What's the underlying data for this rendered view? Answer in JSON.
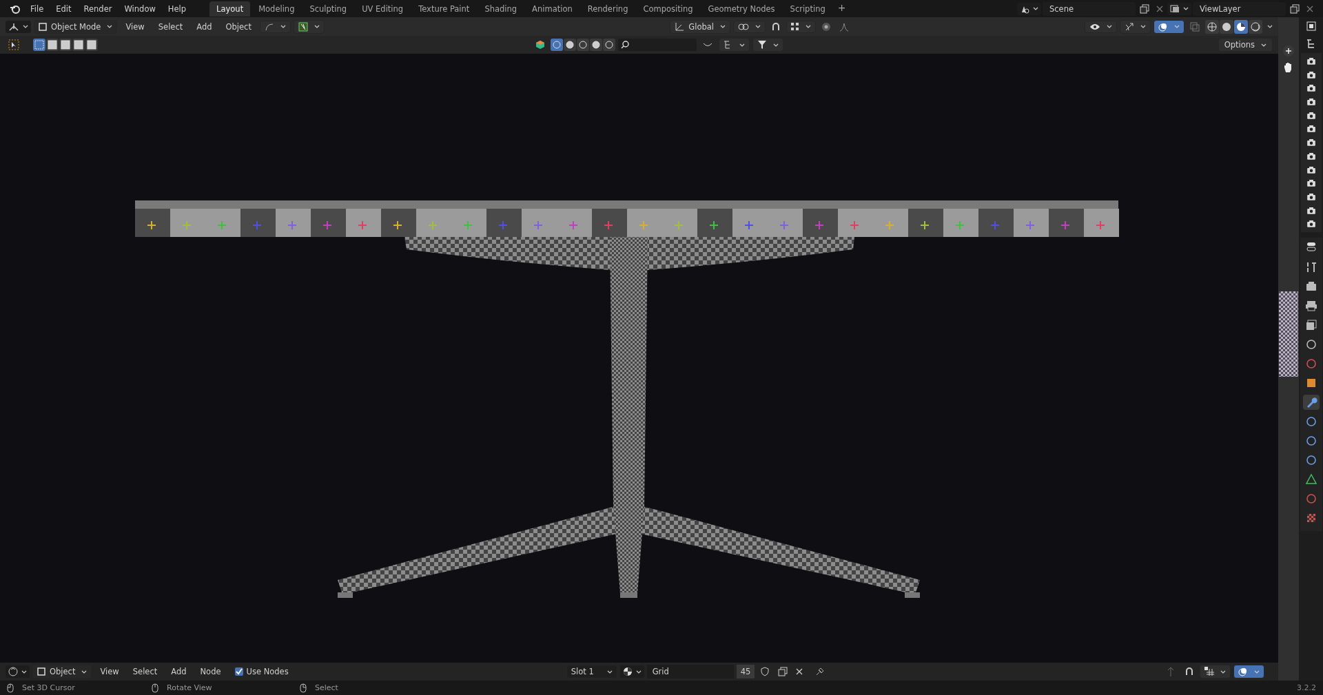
{
  "menu": [
    "File",
    "Edit",
    "Render",
    "Window",
    "Help"
  ],
  "workspaces": [
    {
      "label": "Layout",
      "selected": true
    },
    {
      "label": "Modeling",
      "selected": false
    },
    {
      "label": "Sculpting",
      "selected": false
    },
    {
      "label": "UV Editing",
      "selected": false
    },
    {
      "label": "Texture Paint",
      "selected": false
    },
    {
      "label": "Shading",
      "selected": false
    },
    {
      "label": "Animation",
      "selected": false
    },
    {
      "label": "Rendering",
      "selected": false
    },
    {
      "label": "Compositing",
      "selected": false
    },
    {
      "label": "Geometry Nodes",
      "selected": false
    },
    {
      "label": "Scripting",
      "selected": false
    }
  ],
  "add_workspace": "+",
  "scene": "Scene",
  "view_layer": "ViewLayer",
  "viewport_header": {
    "mode": "Object Mode",
    "menus": [
      "View",
      "Select",
      "Add",
      "Object"
    ],
    "orientation": "Global",
    "options": "Options"
  },
  "select_modes": [
    {
      "selected": true
    },
    {
      "selected": false
    },
    {
      "selected": false
    },
    {
      "selected": false
    },
    {
      "selected": false
    }
  ],
  "shading_modes": [
    {
      "selected": false
    },
    {
      "selected": false
    },
    {
      "selected": true
    },
    {
      "selected": false
    }
  ],
  "properties_tabs": [
    {
      "selected": false
    },
    {
      "selected": false
    },
    {
      "selected": false
    },
    {
      "selected": false
    },
    {
      "selected": false
    },
    {
      "selected": false
    },
    {
      "selected": false
    },
    {
      "selected": true
    },
    {
      "selected": false
    },
    {
      "selected": false
    },
    {
      "selected": false
    },
    {
      "selected": false
    },
    {
      "selected": false
    },
    {
      "selected": false
    }
  ],
  "shader_header": {
    "mode": "Object",
    "menus": [
      "View",
      "Select",
      "Add",
      "Node"
    ],
    "use_nodes": {
      "label": "Use Nodes",
      "checked": true
    },
    "slot": "Slot 1",
    "material": "Grid",
    "users": "45"
  },
  "status_bar": {
    "hints": [
      "Set 3D Cursor",
      "Rotate View",
      "Select"
    ],
    "version": "3.2.2"
  }
}
